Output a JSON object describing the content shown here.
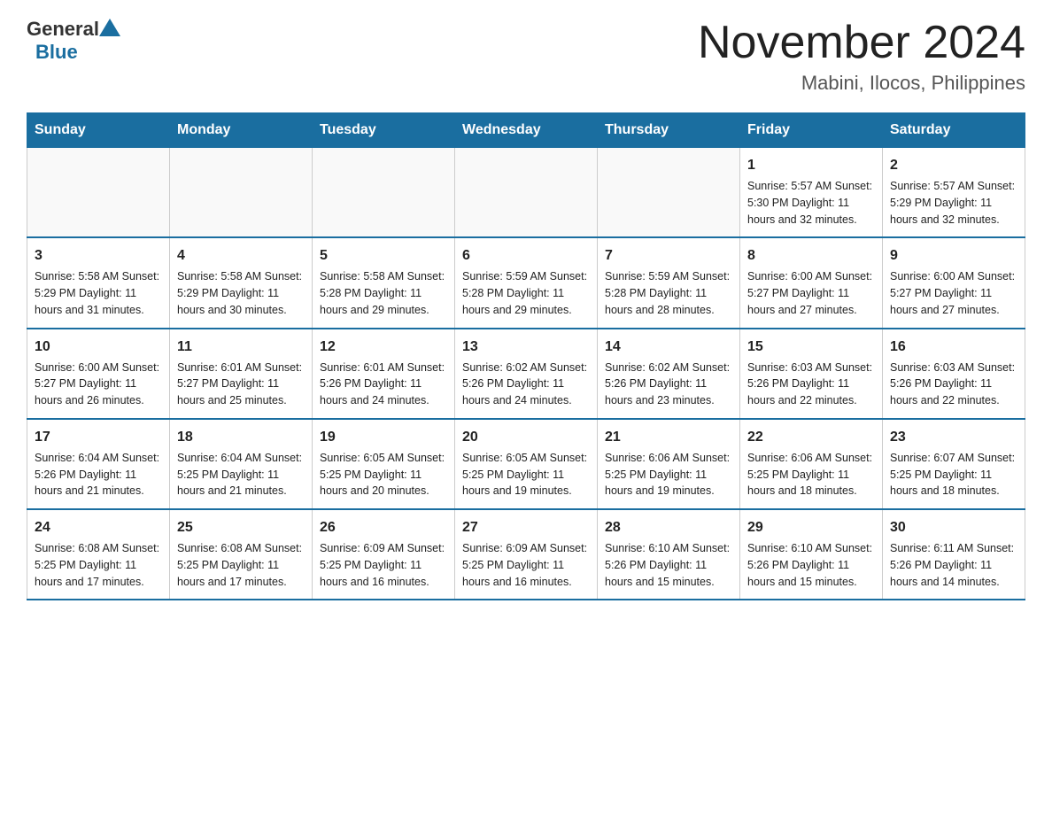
{
  "header": {
    "logo_general": "General",
    "logo_blue": "Blue",
    "title": "November 2024",
    "subtitle": "Mabini, Ilocos, Philippines"
  },
  "weekdays": [
    "Sunday",
    "Monday",
    "Tuesday",
    "Wednesday",
    "Thursday",
    "Friday",
    "Saturday"
  ],
  "weeks": [
    [
      {
        "day": "",
        "info": ""
      },
      {
        "day": "",
        "info": ""
      },
      {
        "day": "",
        "info": ""
      },
      {
        "day": "",
        "info": ""
      },
      {
        "day": "",
        "info": ""
      },
      {
        "day": "1",
        "info": "Sunrise: 5:57 AM\nSunset: 5:30 PM\nDaylight: 11 hours and 32 minutes."
      },
      {
        "day": "2",
        "info": "Sunrise: 5:57 AM\nSunset: 5:29 PM\nDaylight: 11 hours and 32 minutes."
      }
    ],
    [
      {
        "day": "3",
        "info": "Sunrise: 5:58 AM\nSunset: 5:29 PM\nDaylight: 11 hours and 31 minutes."
      },
      {
        "day": "4",
        "info": "Sunrise: 5:58 AM\nSunset: 5:29 PM\nDaylight: 11 hours and 30 minutes."
      },
      {
        "day": "5",
        "info": "Sunrise: 5:58 AM\nSunset: 5:28 PM\nDaylight: 11 hours and 29 minutes."
      },
      {
        "day": "6",
        "info": "Sunrise: 5:59 AM\nSunset: 5:28 PM\nDaylight: 11 hours and 29 minutes."
      },
      {
        "day": "7",
        "info": "Sunrise: 5:59 AM\nSunset: 5:28 PM\nDaylight: 11 hours and 28 minutes."
      },
      {
        "day": "8",
        "info": "Sunrise: 6:00 AM\nSunset: 5:27 PM\nDaylight: 11 hours and 27 minutes."
      },
      {
        "day": "9",
        "info": "Sunrise: 6:00 AM\nSunset: 5:27 PM\nDaylight: 11 hours and 27 minutes."
      }
    ],
    [
      {
        "day": "10",
        "info": "Sunrise: 6:00 AM\nSunset: 5:27 PM\nDaylight: 11 hours and 26 minutes."
      },
      {
        "day": "11",
        "info": "Sunrise: 6:01 AM\nSunset: 5:27 PM\nDaylight: 11 hours and 25 minutes."
      },
      {
        "day": "12",
        "info": "Sunrise: 6:01 AM\nSunset: 5:26 PM\nDaylight: 11 hours and 24 minutes."
      },
      {
        "day": "13",
        "info": "Sunrise: 6:02 AM\nSunset: 5:26 PM\nDaylight: 11 hours and 24 minutes."
      },
      {
        "day": "14",
        "info": "Sunrise: 6:02 AM\nSunset: 5:26 PM\nDaylight: 11 hours and 23 minutes."
      },
      {
        "day": "15",
        "info": "Sunrise: 6:03 AM\nSunset: 5:26 PM\nDaylight: 11 hours and 22 minutes."
      },
      {
        "day": "16",
        "info": "Sunrise: 6:03 AM\nSunset: 5:26 PM\nDaylight: 11 hours and 22 minutes."
      }
    ],
    [
      {
        "day": "17",
        "info": "Sunrise: 6:04 AM\nSunset: 5:26 PM\nDaylight: 11 hours and 21 minutes."
      },
      {
        "day": "18",
        "info": "Sunrise: 6:04 AM\nSunset: 5:25 PM\nDaylight: 11 hours and 21 minutes."
      },
      {
        "day": "19",
        "info": "Sunrise: 6:05 AM\nSunset: 5:25 PM\nDaylight: 11 hours and 20 minutes."
      },
      {
        "day": "20",
        "info": "Sunrise: 6:05 AM\nSunset: 5:25 PM\nDaylight: 11 hours and 19 minutes."
      },
      {
        "day": "21",
        "info": "Sunrise: 6:06 AM\nSunset: 5:25 PM\nDaylight: 11 hours and 19 minutes."
      },
      {
        "day": "22",
        "info": "Sunrise: 6:06 AM\nSunset: 5:25 PM\nDaylight: 11 hours and 18 minutes."
      },
      {
        "day": "23",
        "info": "Sunrise: 6:07 AM\nSunset: 5:25 PM\nDaylight: 11 hours and 18 minutes."
      }
    ],
    [
      {
        "day": "24",
        "info": "Sunrise: 6:08 AM\nSunset: 5:25 PM\nDaylight: 11 hours and 17 minutes."
      },
      {
        "day": "25",
        "info": "Sunrise: 6:08 AM\nSunset: 5:25 PM\nDaylight: 11 hours and 17 minutes."
      },
      {
        "day": "26",
        "info": "Sunrise: 6:09 AM\nSunset: 5:25 PM\nDaylight: 11 hours and 16 minutes."
      },
      {
        "day": "27",
        "info": "Sunrise: 6:09 AM\nSunset: 5:25 PM\nDaylight: 11 hours and 16 minutes."
      },
      {
        "day": "28",
        "info": "Sunrise: 6:10 AM\nSunset: 5:26 PM\nDaylight: 11 hours and 15 minutes."
      },
      {
        "day": "29",
        "info": "Sunrise: 6:10 AM\nSunset: 5:26 PM\nDaylight: 11 hours and 15 minutes."
      },
      {
        "day": "30",
        "info": "Sunrise: 6:11 AM\nSunset: 5:26 PM\nDaylight: 11 hours and 14 minutes."
      }
    ]
  ]
}
